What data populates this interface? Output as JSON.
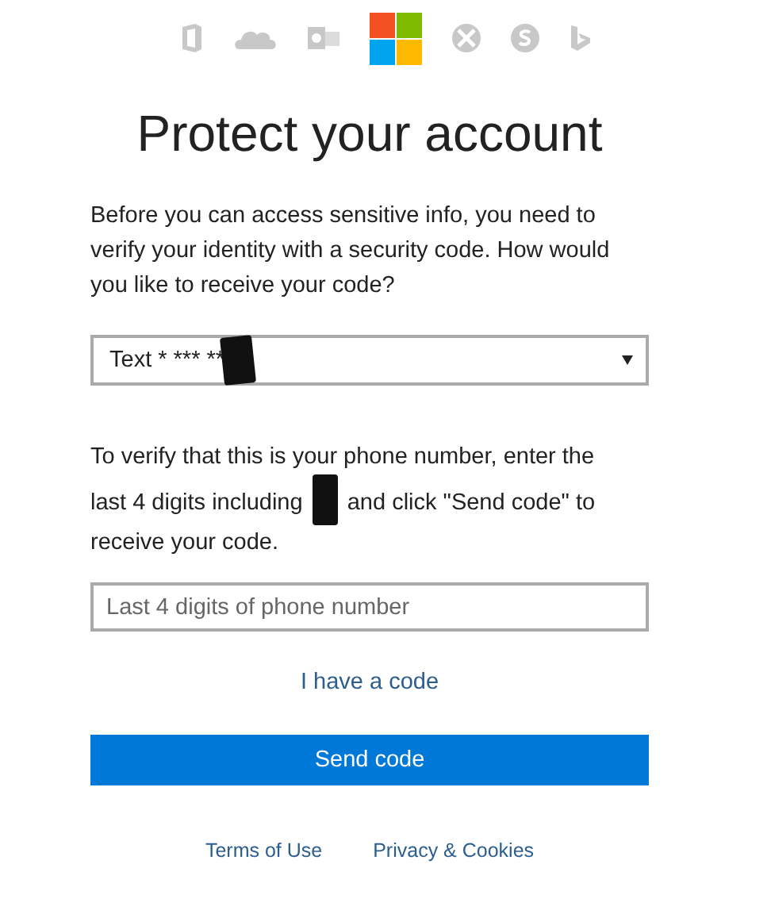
{
  "title": "Protect your account",
  "intro": "Before you can access sensitive info, you need to verify your identity with a security code. How would you like to receive your code?",
  "method_select": {
    "value": "Text * *** **",
    "redacted": true
  },
  "verify_text": {
    "before": "To verify that this is your phone number, enter the last 4 digits including",
    "after": "and click \"Send code\" to receive your code.",
    "redacted": true
  },
  "digits_field": {
    "placeholder": "Last 4 digits of phone number"
  },
  "have_code_link": "I have a code",
  "send_button": "Send code",
  "footer_links": [
    "Terms of Use",
    "Privacy & Cookies"
  ]
}
